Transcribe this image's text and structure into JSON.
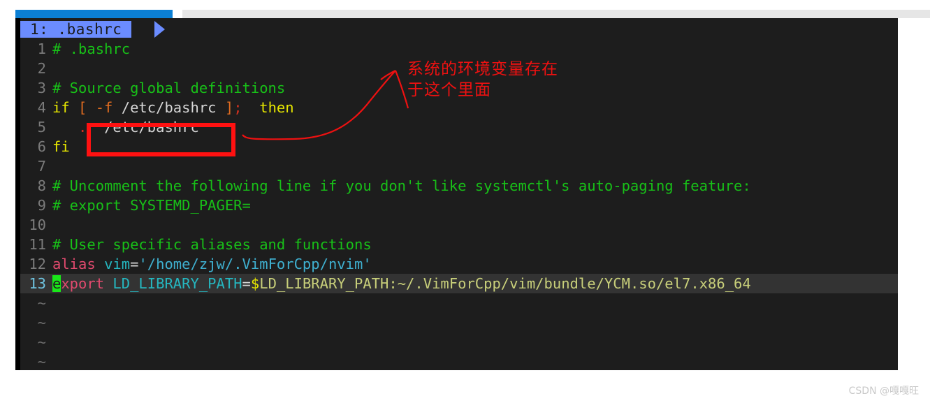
{
  "window": {
    "app": "vim",
    "background_color": "#1d1d1d"
  },
  "browser_chrome": {
    "active_tab_color": "#0b7fd4",
    "tabstrip_color": "#e6e6e6"
  },
  "tabline": {
    "active_tab_label": "1: .bashrc",
    "active_tab_bg": "#6b8cff"
  },
  "editor": {
    "filename": ".bashrc",
    "cursor_line": 13,
    "cursor_col": 1,
    "cursor_color": "#19e619",
    "lines": [
      {
        "num": "1",
        "text": "# .bashrc"
      },
      {
        "num": "2",
        "text": ""
      },
      {
        "num": "3",
        "text": "# Source global definitions"
      },
      {
        "num": "4",
        "text": "if [ -f /etc/bashrc ]; then"
      },
      {
        "num": "5",
        "text": "    . /etc/bashrc"
      },
      {
        "num": "6",
        "text": "fi"
      },
      {
        "num": "7",
        "text": ""
      },
      {
        "num": "8",
        "text": "# Uncomment the following line if you don't like systemctl's auto-paging feature:"
      },
      {
        "num": "9",
        "text": "# export SYSTEMD_PAGER="
      },
      {
        "num": "10",
        "text": ""
      },
      {
        "num": "11",
        "text": "# User specific aliases and functions"
      },
      {
        "num": "12",
        "text": "alias vim='/home/zjw/.VimForCpp/nvim'"
      },
      {
        "num": "13",
        "text": "export LD_LIBRARY_PATH=$LD_LIBRARY_PATH:~/.VimForCpp/vim/bundle/YCM.so/el7.x86_64"
      }
    ],
    "line1": {
      "comment": "# .bashrc"
    },
    "line3": {
      "comment": "# Source global definitions"
    },
    "line4": {
      "kw_if": "if",
      "lb": "[",
      "flag": "-f",
      "path": "/etc/bashrc",
      "rb": "]",
      "semi": ";",
      "kw_then": "then"
    },
    "line5": {
      "dot": ".",
      "path": "/etc/bashrc"
    },
    "line6": {
      "kw_fi": "fi"
    },
    "line8": {
      "comment": "# Uncomment the following line if you don't like systemctl's auto-paging feature:"
    },
    "line9": {
      "comment": "# export SYSTEMD_PAGER="
    },
    "line11": {
      "comment": "# User specific aliases and functions"
    },
    "line12": {
      "kw_alias": "alias",
      "name": "vim",
      "eq": "=",
      "value": "'/home/zjw/.VimForCpp/nvim'"
    },
    "line13": {
      "cursor_char": "e",
      "kw_rest": "xport",
      "varname": "LD_LIBRARY_PATH",
      "eq": "=",
      "dollar": "$",
      "value": "LD_LIBRARY_PATH:~/.VimForCpp/vim/bundle/YCM.so/el7.x86_64"
    },
    "empty_markers": [
      "~",
      "~",
      "~",
      "~"
    ]
  },
  "annotations": {
    "box_color": "#ff1111",
    "arrow_color": "#ee1111",
    "note_line1": "系统的环境变量存在",
    "note_line2": "于这个里面",
    "note_color": "#ee1111"
  },
  "watermark": {
    "text": "CSDN @嘎嘎旺"
  }
}
